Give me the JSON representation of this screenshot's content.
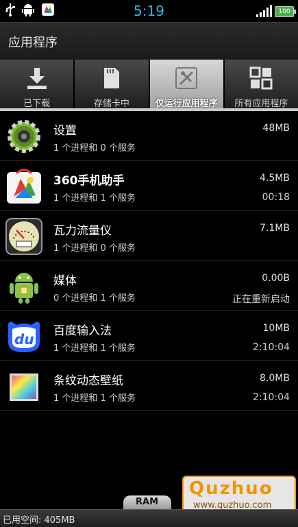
{
  "status_bar": {
    "time": "5:19",
    "battery": "100",
    "icons": [
      "usb-icon",
      "android-debug-icon",
      "app-notification-icon",
      "signal-icon",
      "battery-icon"
    ]
  },
  "title": "应用程序",
  "tabs": [
    {
      "label": "已下载",
      "icon": "download-icon",
      "active": false
    },
    {
      "label": "存储卡中",
      "icon": "sd-card-icon",
      "active": false
    },
    {
      "label": "仅运行应用程序",
      "icon": "running-app-icon",
      "active": true
    },
    {
      "label": "所有应用程序",
      "icon": "grid-icon",
      "active": false
    }
  ],
  "apps": [
    {
      "name": "设置",
      "sub": "1 个进程和 0 个服务",
      "size": "48MB",
      "time": "",
      "icon": "settings-gear-icon"
    },
    {
      "name": "360手机助手",
      "sub": "1 个进程和 1 个服务",
      "size": "4.5MB",
      "time": "00:18",
      "icon": "360-assistant-icon"
    },
    {
      "name": "瓦力流量仪",
      "sub": "1 个进程和 0 个服务",
      "size": "7.1MB",
      "time": "",
      "icon": "traffic-meter-icon"
    },
    {
      "name": "媒体",
      "sub": "0 个进程和 1 个服务",
      "size": "0.00B",
      "time": "正在重新启动",
      "icon": "android-robot-icon"
    },
    {
      "name": "百度输入法",
      "sub": "1 个进程和 1 个服务",
      "size": "10MB",
      "time": "2:10:04",
      "icon": "baidu-du-icon"
    },
    {
      "name": "条纹动态壁纸",
      "sub": "1 个进程和 1 个服务",
      "size": "8.0MB",
      "time": "2:10:04",
      "icon": "wallpaper-icon"
    }
  ],
  "ram_label": "RAM",
  "used_space": "已用空间: 405MB",
  "watermark": {
    "brand": "Quzhuo",
    "url": "www.quzhuo.com"
  },
  "colors": {
    "time": "#33b5e5",
    "battery": "#4caf50",
    "watermark": "#f29400"
  }
}
